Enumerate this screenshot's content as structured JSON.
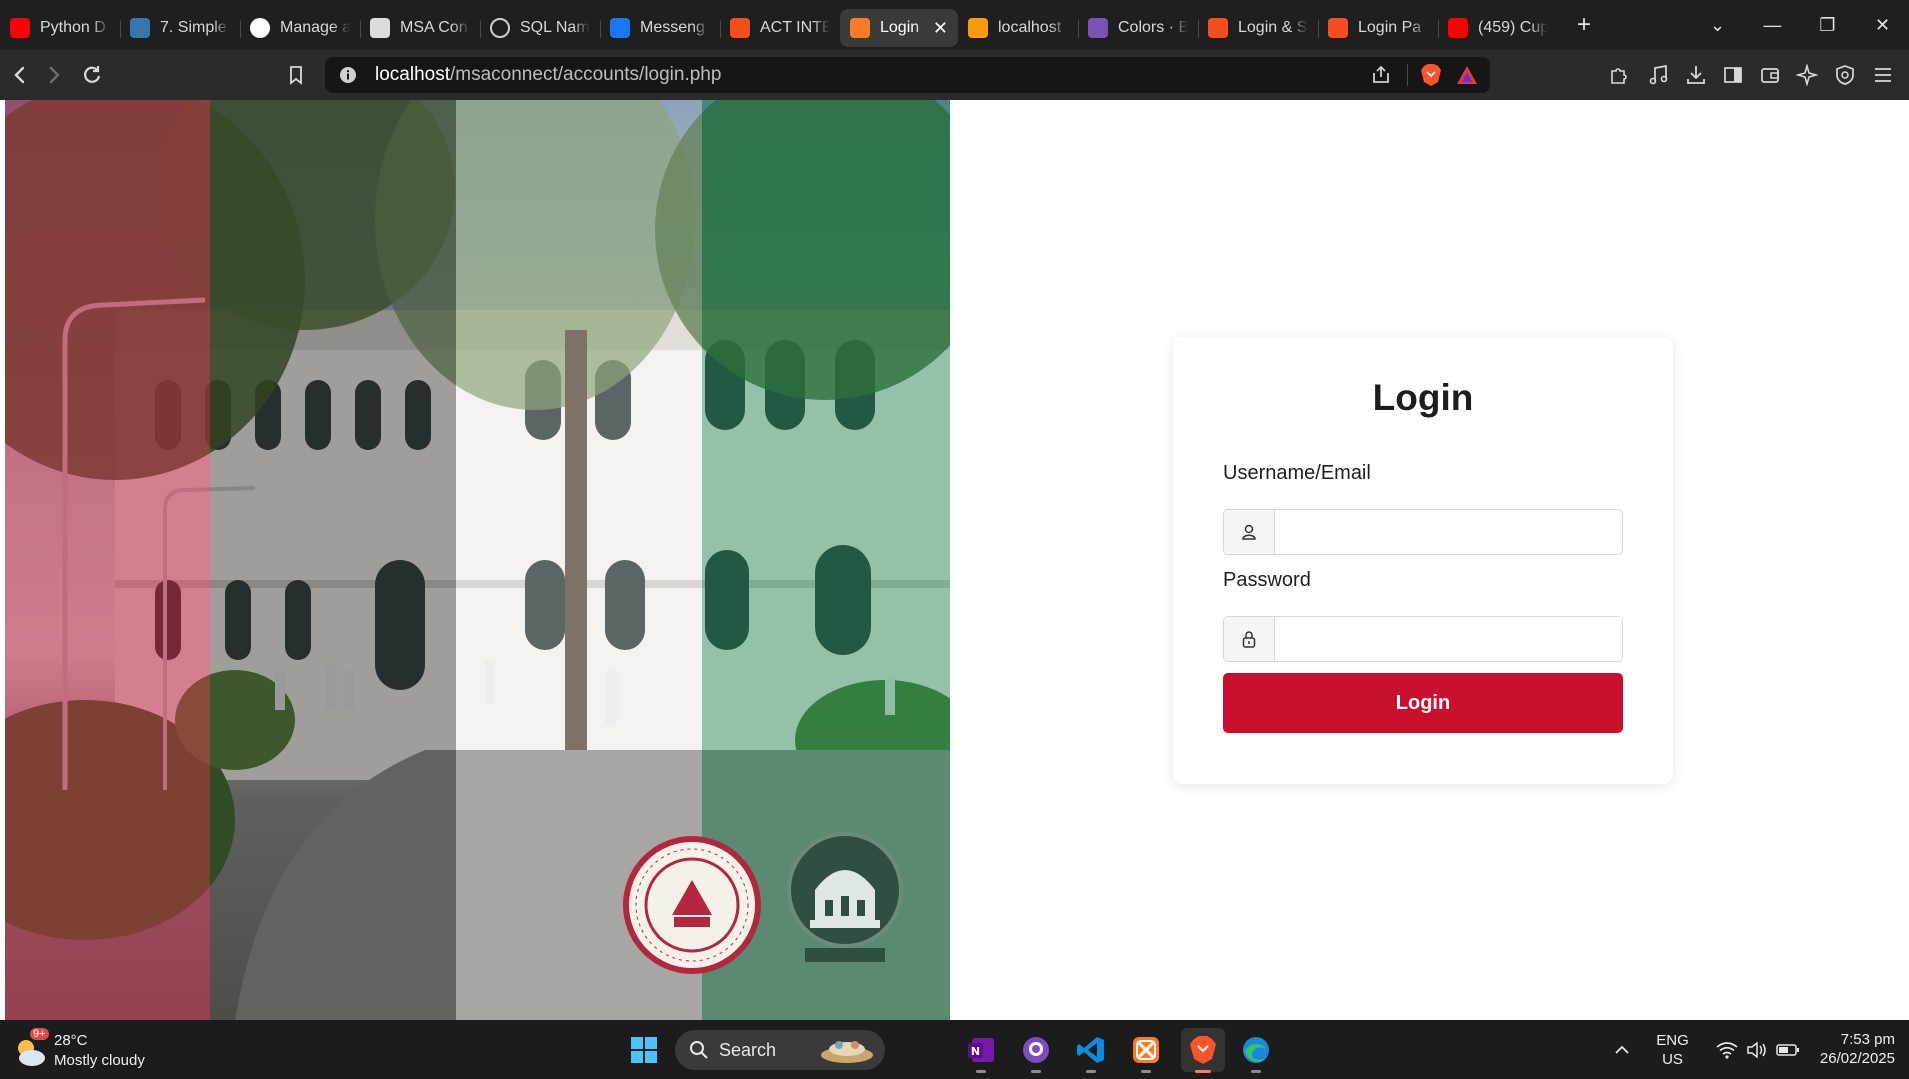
{
  "browser": {
    "tabs": [
      {
        "title": "Python D",
        "icon": "youtube-icon",
        "color": "#ff0000"
      },
      {
        "title": "7. Simple",
        "icon": "python-icon",
        "color": "#3776ab"
      },
      {
        "title": "Manage a",
        "icon": "github-icon",
        "color": "#ffffff"
      },
      {
        "title": "MSA Con",
        "icon": "page-icon",
        "color": "#dcdcdc"
      },
      {
        "title": "SQL Nam",
        "icon": "openai-icon",
        "color": "#cfcfcf"
      },
      {
        "title": "Messeng",
        "icon": "facebook-icon",
        "color": "#1877f2"
      },
      {
        "title": "ACT INTE",
        "icon": "figma-icon",
        "color": "#f24e1e"
      },
      {
        "title": "Login",
        "icon": "xampp-icon",
        "color": "#fb7a24",
        "active": true
      },
      {
        "title": "localhost",
        "icon": "phpmyadmin-icon",
        "color": "#f89c0e"
      },
      {
        "title": "Colors · B",
        "icon": "bootstrap-icon",
        "color": "#7952b3"
      },
      {
        "title": "Login & S",
        "icon": "figma-icon",
        "color": "#f24e1e"
      },
      {
        "title": "Login Pa",
        "icon": "figma-icon",
        "color": "#f24e1e"
      },
      {
        "title": "(459) Cup",
        "icon": "youtube-icon",
        "color": "#ff0000"
      }
    ],
    "url_host": "localhost",
    "url_path": "/msaconnect/accounts/login.php"
  },
  "login": {
    "title": "Login",
    "username_label": "Username/Email",
    "password_label": "Password",
    "username_value": "",
    "password_value": "",
    "submit_label": "Login"
  },
  "colors": {
    "brand_red": "#c8102e",
    "stripe_red": "#b3263f",
    "stripe_green": "#2e8b57"
  },
  "taskbar": {
    "weather_temp": "28°C",
    "weather_desc": "Mostly cloudy",
    "weather_badge": "9+",
    "search_label": "Search",
    "lang": "ENG",
    "region": "US",
    "time": "7:53 pm",
    "date": "26/02/2025"
  }
}
